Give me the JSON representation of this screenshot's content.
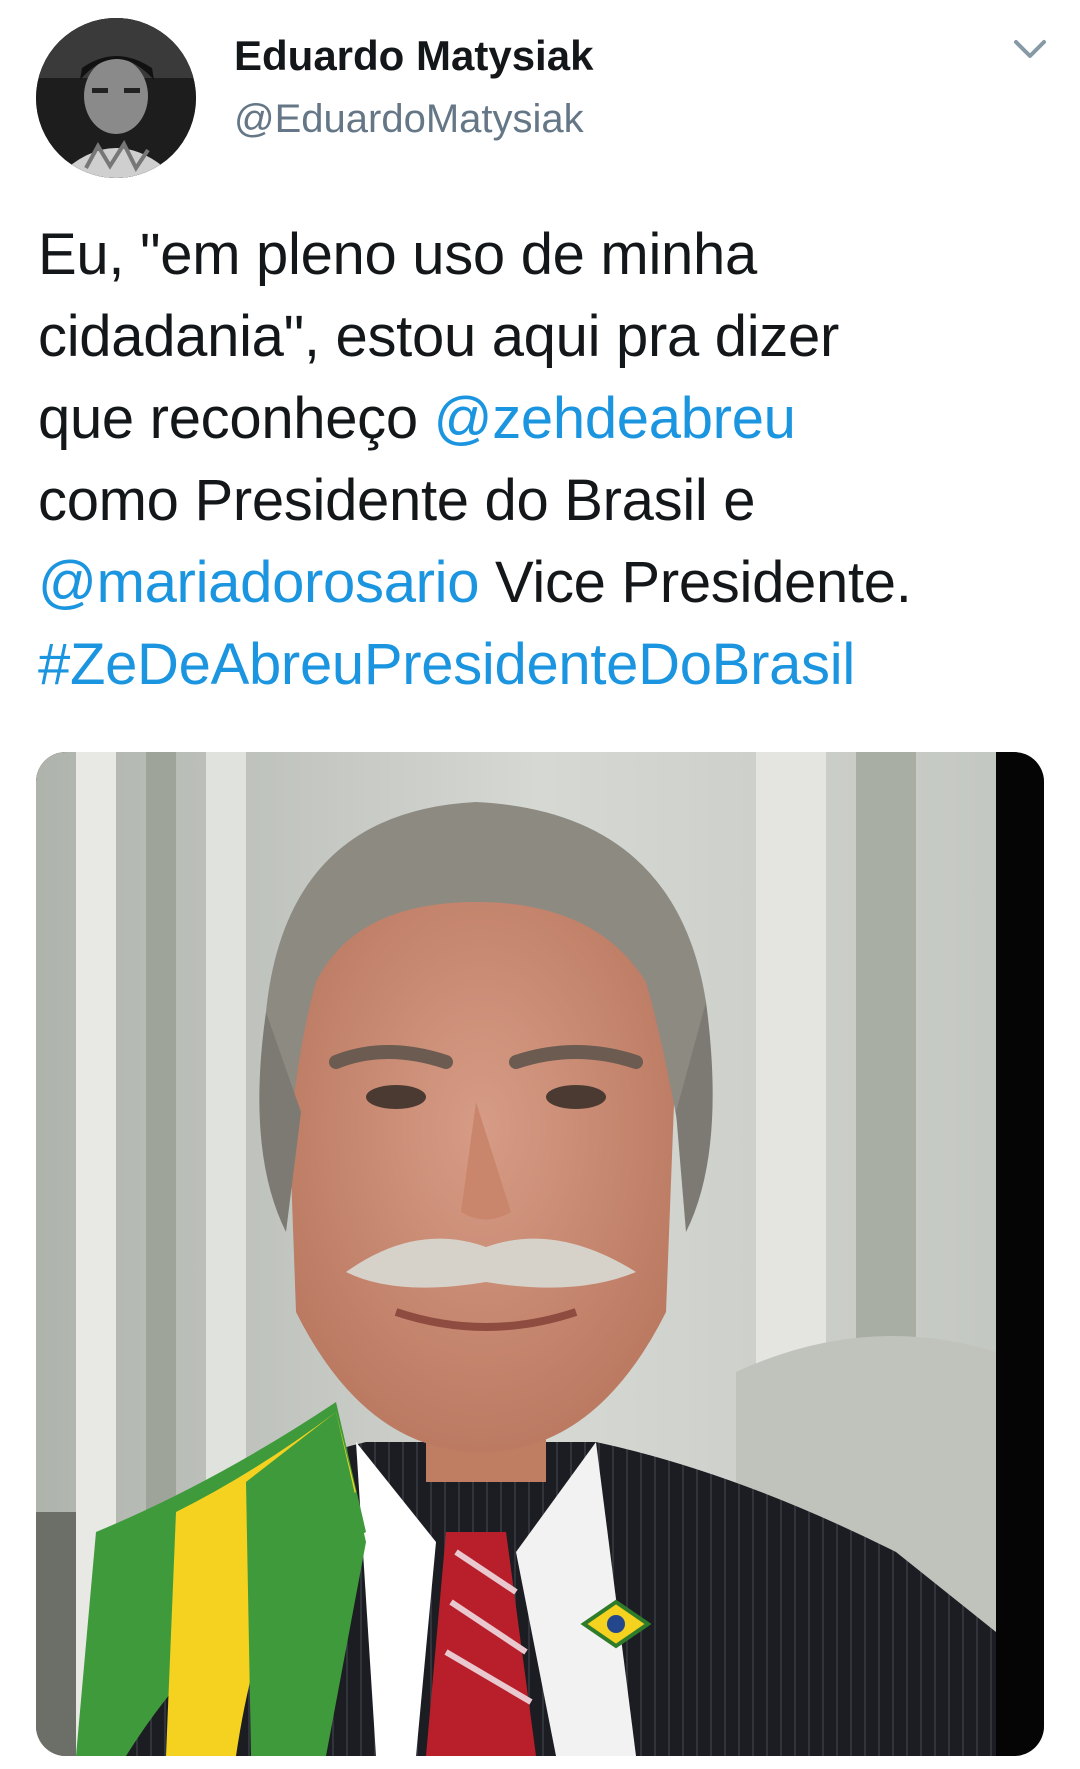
{
  "tweet": {
    "author": {
      "display_name": "Eduardo Matysiak",
      "handle": "@EduardoMatysiak"
    },
    "menu_icon": "chevron-down-icon",
    "text_lines": [
      [
        {
          "text": "Eu, \"em pleno uso de minha"
        }
      ],
      [
        {
          "text": "cidadania\", estou aqui pra dizer"
        }
      ],
      [
        {
          "text": "que reconheço "
        },
        {
          "text": "@zehdeabreu",
          "link": true
        }
      ],
      [
        {
          "text": "como Presidente do Brasil e"
        }
      ],
      [
        {
          "text": "@mariadorosario",
          "link": true
        },
        {
          "text": " Vice Presidente."
        }
      ],
      [
        {
          "text": "#ZeDeAbreuPresidenteDoBrasil",
          "link": true
        }
      ]
    ],
    "media": {
      "kind": "photo",
      "subject": "man in suit with presidential sash"
    }
  },
  "colors": {
    "link": "#1b95e0",
    "text": "#14171a",
    "secondary": "#657786",
    "sash_green": "#3f9a3c",
    "sash_yellow": "#f4d21f"
  }
}
